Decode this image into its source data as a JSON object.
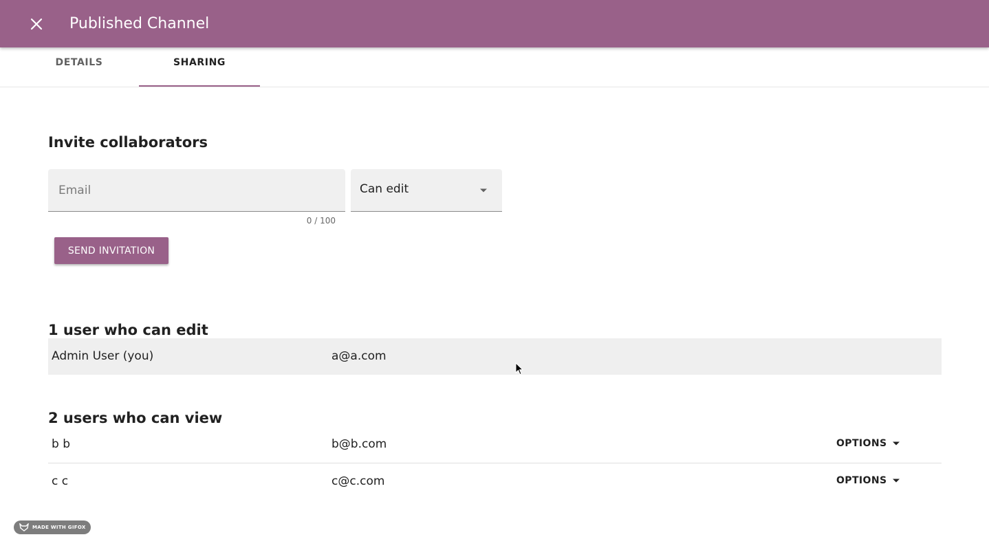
{
  "appbar": {
    "title": "Published Channel",
    "close_icon": "close-icon",
    "color": "#996189"
  },
  "tabs": [
    {
      "label": "DETAILS",
      "active": false
    },
    {
      "label": "SHARING",
      "active": true
    }
  ],
  "invite": {
    "heading": "Invite collaborators",
    "email_placeholder": "Email",
    "email_value": "",
    "counter": "0 / 100",
    "permission_selected": "Can edit",
    "send_label": "SEND INVITATION"
  },
  "editors": {
    "heading": "1 user who can edit",
    "users": [
      {
        "name": "Admin User (you)",
        "email": "a@a.com"
      }
    ]
  },
  "viewers": {
    "heading": "2 users who can view",
    "users": [
      {
        "name": "b b",
        "email": "b@b.com",
        "options_label": "OPTIONS"
      },
      {
        "name": "c c",
        "email": "c@c.com",
        "options_label": "OPTIONS"
      }
    ]
  },
  "watermark": {
    "text": "MADE WITH GIFOX"
  }
}
